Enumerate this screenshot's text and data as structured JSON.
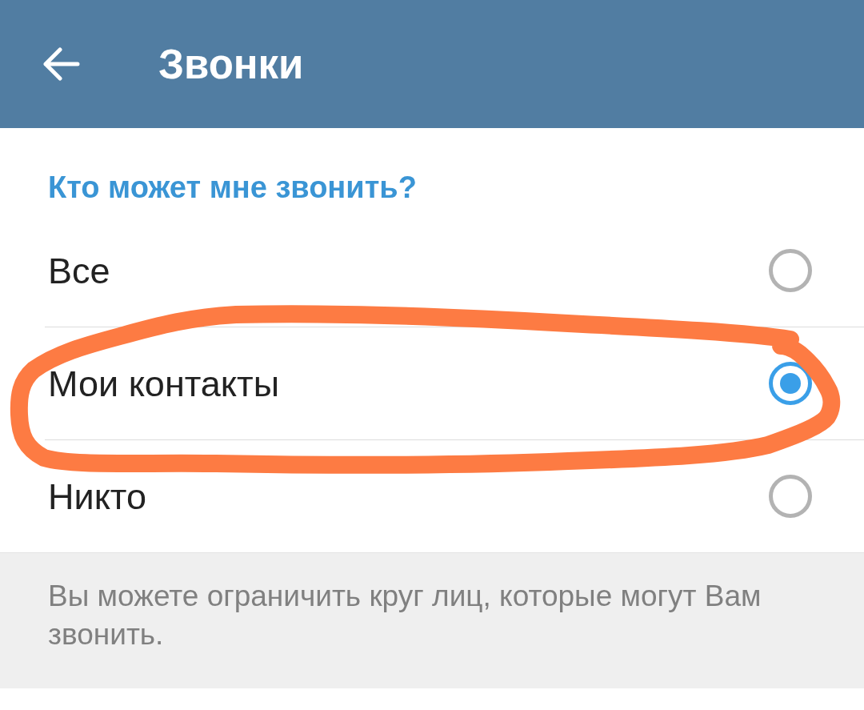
{
  "header": {
    "title": "Звонки"
  },
  "section": {
    "title": "Кто может мне звонить?",
    "options": [
      {
        "label": "Все",
        "selected": false,
        "circled": false
      },
      {
        "label": "Мои контакты",
        "selected": true,
        "circled": true
      },
      {
        "label": "Никто",
        "selected": false,
        "circled": false
      }
    ]
  },
  "hint": "Вы можете ограничить круг лиц, которые могут Вам звонить."
}
